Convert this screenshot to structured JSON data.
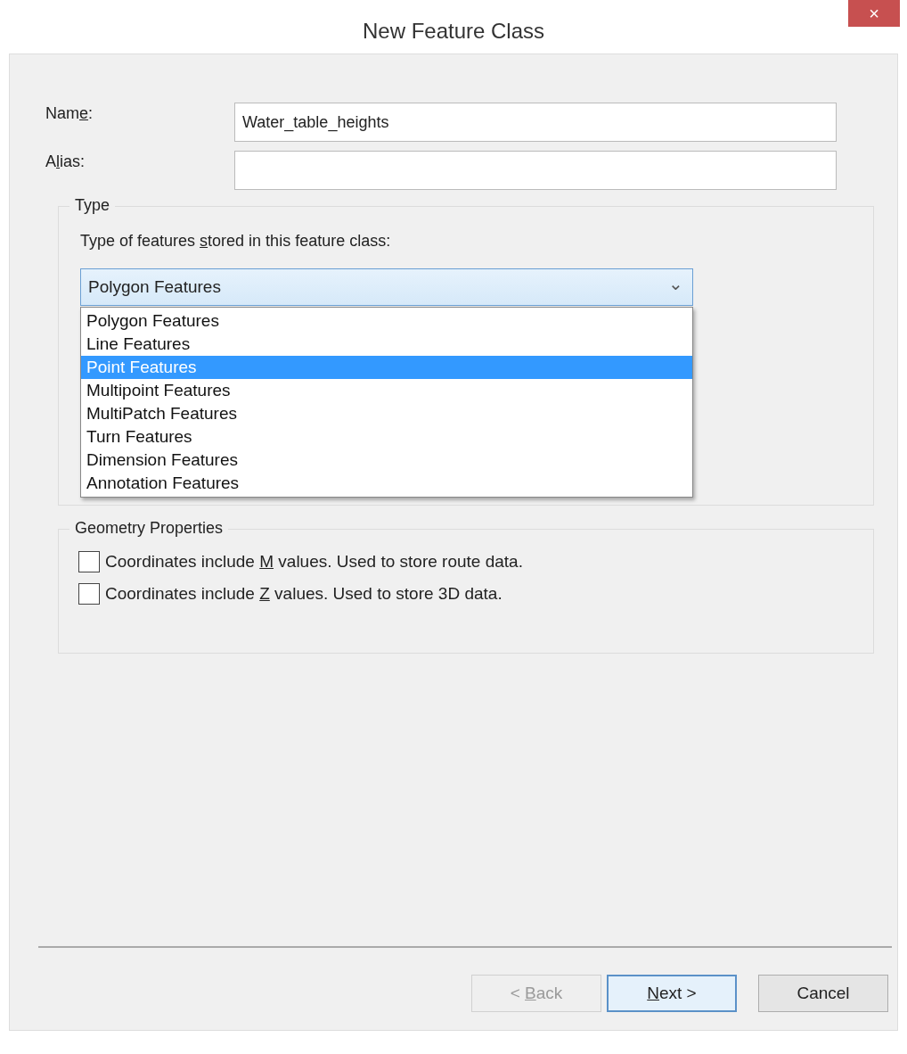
{
  "window": {
    "title": "New Feature Class",
    "close": "×"
  },
  "fields": [
    {
      "label": {
        "before": "Nam",
        "key": "e",
        "after": ":"
      },
      "value": "Water_table_heights"
    },
    {
      "label": {
        "before": "A",
        "key": "l",
        "after": "ias:"
      }
    }
  ],
  "type_group": {
    "legend": "Type",
    "prompt": {
      "before": "Type of features ",
      "key": "s",
      "after": "tored in this feature class:"
    },
    "combo": {
      "value": "Polygon Features",
      "expanded": true,
      "arrow": "⌄"
    },
    "options": [
      {
        "label": "Polygon Features",
        "selected": false
      },
      {
        "label": "Line Features",
        "selected": false
      },
      {
        "label": "Point Features",
        "selected": true
      },
      {
        "label": "Multipoint Features",
        "selected": false
      },
      {
        "label": "MultiPatch Features",
        "selected": false
      },
      {
        "label": "Turn Features",
        "selected": false
      },
      {
        "label": "Dimension Features",
        "selected": false
      },
      {
        "label": "Annotation Features",
        "selected": false
      }
    ]
  },
  "geometry_group": {
    "legend": "Geometry Properties",
    "checkboxes": [
      {
        "label": {
          "before": "Coordinates include ",
          "key": "M",
          "after": " values. Used to store route data."
        },
        "checked": false
      },
      {
        "label": {
          "before": "Coordinates include ",
          "key": "Z",
          "after": " values. Used to store 3D data."
        },
        "checked": false
      }
    ]
  },
  "buttons": [
    {
      "label": {
        "before": "< ",
        "key": "B",
        "after": "ack"
      },
      "disabled": true,
      "default": false
    },
    {
      "label": {
        "key": "N",
        "after": "ext >"
      },
      "disabled": false,
      "default": true
    },
    {
      "label": {
        "before": "Cancel"
      },
      "disabled": false,
      "default": false
    }
  ]
}
